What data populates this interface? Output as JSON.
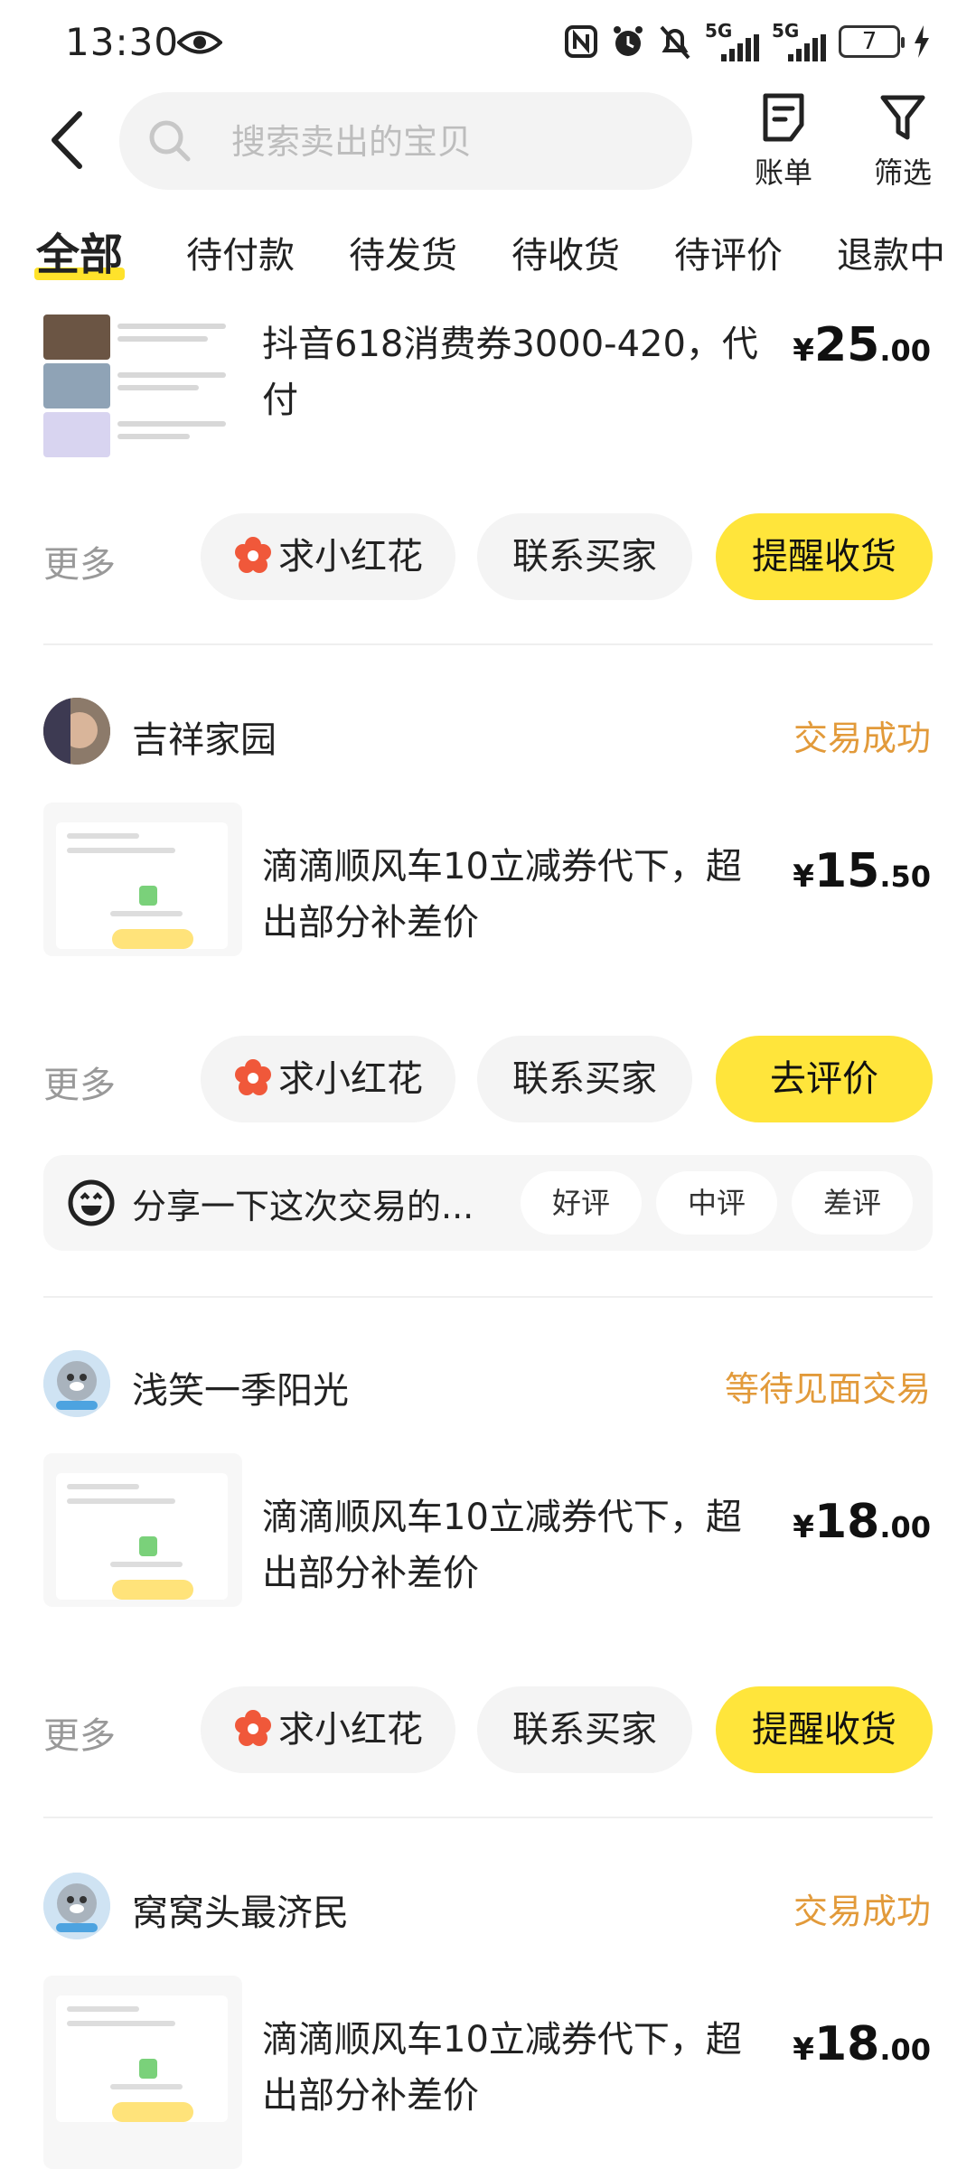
{
  "status_bar": {
    "time": "13:30",
    "battery": "7",
    "signal1": "5G",
    "signal2": "5G"
  },
  "header": {
    "search_placeholder": "搜索卖出的宝贝",
    "bill_label": "账单",
    "filter_label": "筛选"
  },
  "tabs": [
    {
      "label": "全部",
      "active": true
    },
    {
      "label": "待付款"
    },
    {
      "label": "待发货"
    },
    {
      "label": "待收货"
    },
    {
      "label": "待评价"
    },
    {
      "label": "退款中"
    }
  ],
  "orders": [
    {
      "title": "抖音618消费券3000-420，代付",
      "title_line1": "抖音618消费券3000-420，代",
      "title_line2": "付",
      "price_yen": "¥",
      "price_int": "25",
      "price_dec": ".00",
      "more": "更多",
      "flower_btn": "求小红花",
      "contact_btn": "联系买家",
      "action_btn": "提醒收货"
    },
    {
      "buyer": "吉祥家园",
      "status": "交易成功",
      "title_line1": "滴滴顺风车10立减券代下，超",
      "title_line2": "出部分补差价",
      "price_yen": "¥",
      "price_int": "15",
      "price_dec": ".50",
      "more": "更多",
      "flower_btn": "求小红花",
      "contact_btn": "联系买家",
      "action_btn": "去评价",
      "review_prompt": "分享一下这次交易的...",
      "review_good": "好评",
      "review_mid": "中评",
      "review_bad": "差评"
    },
    {
      "buyer": "浅笑一季阳光",
      "status": "等待见面交易",
      "title_line1": "滴滴顺风车10立减券代下，超",
      "title_line2": "出部分补差价",
      "price_yen": "¥",
      "price_int": "18",
      "price_dec": ".00",
      "more": "更多",
      "flower_btn": "求小红花",
      "contact_btn": "联系买家",
      "action_btn": "提醒收货"
    },
    {
      "buyer": "窝窝头最济民",
      "status": "交易成功",
      "title_line1": "滴滴顺风车10立减券代下，超",
      "title_line2": "出部分补差价",
      "price_yen": "¥",
      "price_int": "18",
      "price_dec": ".00"
    }
  ],
  "colors": {
    "accent": "#ffe53b",
    "status": "#e29a3a",
    "muted": "#999999"
  }
}
